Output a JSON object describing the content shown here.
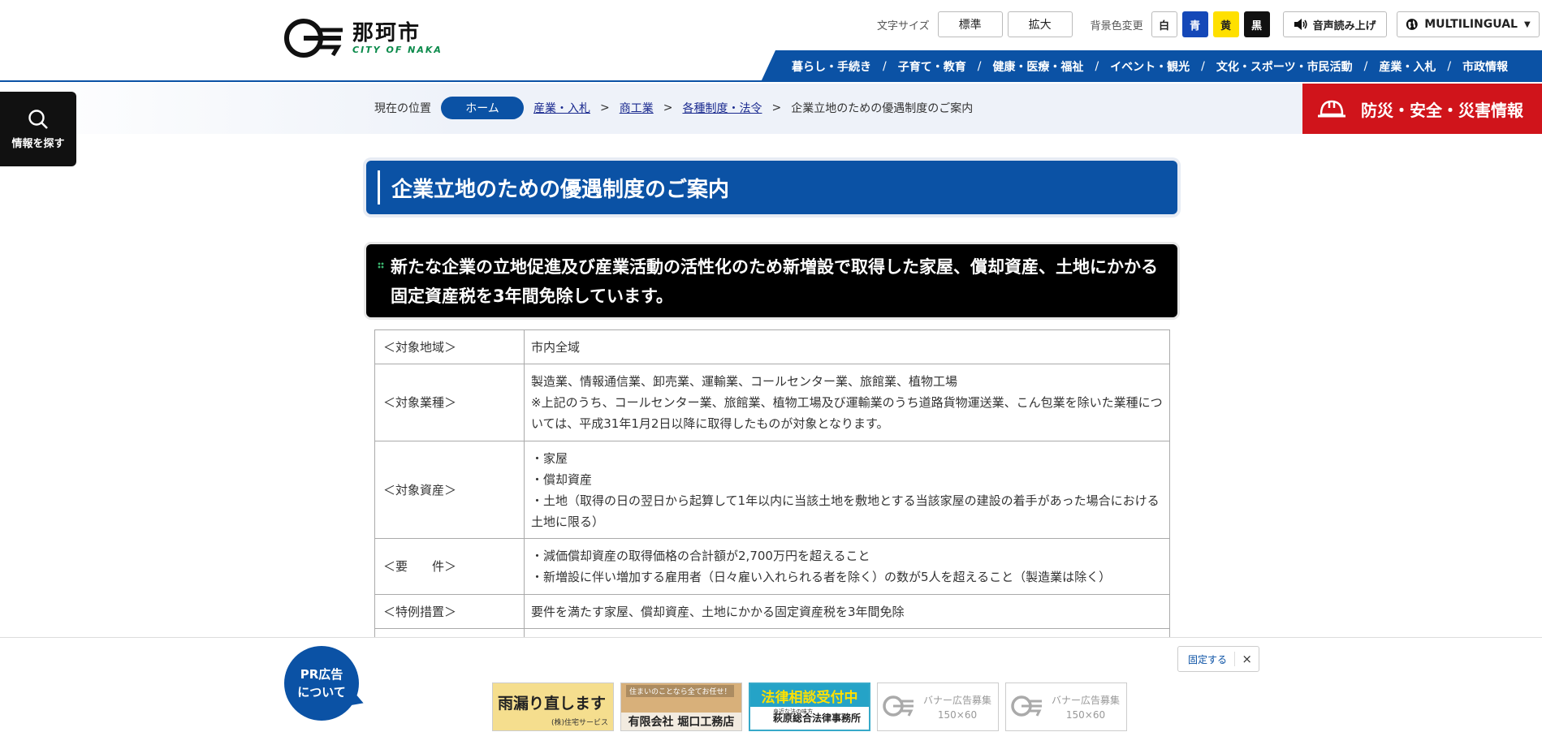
{
  "header": {
    "logo_name": "那珂市",
    "logo_sub": "CITY OF NAKA",
    "font_size_label": "文字サイズ",
    "font_size_standard": "標準",
    "font_size_large": "拡大",
    "bg_color_label": "背景色変更",
    "bg_colors": [
      {
        "label": "白",
        "color": "#ffffff"
      },
      {
        "label": "青",
        "color": "#1448b8"
      },
      {
        "label": "黄",
        "color": "#ffe000"
      },
      {
        "label": "黒",
        "color": "#111111"
      }
    ],
    "voice_label": "音声読み上げ",
    "multilingual_label": "MULTILINGUAL"
  },
  "gnav": [
    "暮らし・手続き",
    "子育て・教育",
    "健康・医療・福祉",
    "イベント・観光",
    "文化・スポーツ・市民活動",
    "産業・入札",
    "市政情報"
  ],
  "breadcrumb": {
    "label": "現在の位置",
    "home": "ホーム",
    "items": [
      "産業・入札",
      "商工業",
      "各種制度・法令"
    ],
    "current": "企業立地のための優遇制度のご案内",
    "sep": ">"
  },
  "disaster_label": "防災・安全・災害情報",
  "search_side_label": "情報を探す",
  "page_title": "企業立地のための優遇制度のご案内",
  "section_heading": "新たな企業の立地促進及び産業活動の活性化のため新増設で取得した家屋、償却資産、土地にかかる固定資産税を3年間免除しています。",
  "table": [
    {
      "key": "＜対象地域＞",
      "lines": [
        "市内全域"
      ]
    },
    {
      "key": "＜対象業種＞",
      "lines": [
        "製造業、情報通信業、卸売業、運輸業、コールセンター業、旅館業、植物工場",
        "※上記のうち、コールセンター業、旅館業、植物工場及び運輸業のうち道路貨物運送業、こん包業を除いた業種については、平成31年1月2日以降に取得したものが対象となります。"
      ]
    },
    {
      "key": "＜対象資産＞",
      "lines": [
        "・家屋",
        "・償却資産",
        "・土地（取得の日の翌日から起算して1年以内に当該土地を敷地とする当該家屋の建設の着手があった場合における土地に限る）"
      ]
    },
    {
      "key": "＜要　　件＞",
      "lines": [
        "・減価償却資産の取得価格の合計額が2,700万円を超えること",
        "・新増設に伴い増加する雇用者（日々雇い入れられる者を除く）の数が5人を超えること（製造業は除く）"
      ]
    },
    {
      "key": "＜特例措置＞",
      "lines": [
        "要件を満たす家屋、償却資産、土地にかかる固定資産税を3年間免除"
      ]
    }
  ],
  "ads": {
    "pr_line1": "PR広告",
    "pr_line2": "について",
    "fix_label": "固定する",
    "close_icon": "×",
    "banners": [
      {
        "title": "雨漏り直します",
        "sub": "(株)住宅サービス"
      },
      {
        "top": "住まいのことなら全てお任せ！",
        "title": "有限会社 堀口工務店"
      },
      {
        "title": "法律相談受付中",
        "small": "身近な法の味方",
        "sub": "萩原総合法律事務所"
      },
      {
        "line1": "バナー広告募集",
        "line2": "150×60"
      },
      {
        "line1": "バナー広告募集",
        "line2": "150×60"
      }
    ]
  }
}
